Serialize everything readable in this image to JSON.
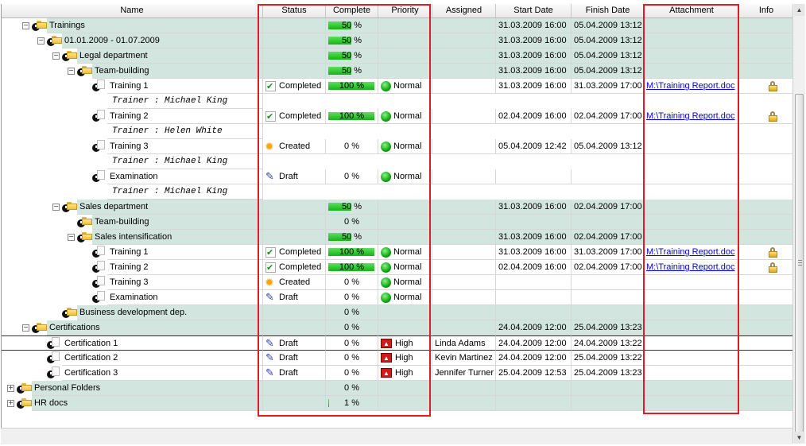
{
  "columns": {
    "name": "Name",
    "status": "Status",
    "complete": "Complete",
    "priority": "Priority",
    "assigned": "Assigned",
    "start_date": "Start Date",
    "finish_date": "Finish Date",
    "attachment": "Attachment",
    "info": "Info"
  },
  "rows": [
    {
      "name": "Trainings",
      "level": 1,
      "kind": "folder",
      "expander": "−",
      "complete_text": "50 %",
      "progress": 0.5,
      "start": "31.03.2009 16:00",
      "finish": "05.04.2009 13:12"
    },
    {
      "name": "01.01.2009 - 01.07.2009",
      "level": 2,
      "kind": "folder",
      "expander": "−",
      "complete_text": "50 %",
      "progress": 0.5,
      "start": "31.03.2009 16:00",
      "finish": "05.04.2009 13:12"
    },
    {
      "name": "Legal department",
      "level": 3,
      "kind": "folder",
      "expander": "−",
      "complete_text": "50 %",
      "progress": 0.5,
      "start": "31.03.2009 16:00",
      "finish": "05.04.2009 13:12"
    },
    {
      "name": "Team-building",
      "level": 4,
      "kind": "folder",
      "expander": "−",
      "complete_text": "50 %",
      "progress": 0.5,
      "start": "31.03.2009 16:00",
      "finish": "05.04.2009 13:12"
    },
    {
      "name": "Training 1",
      "level": 5,
      "kind": "task",
      "status": "Completed",
      "status_icon": "completed",
      "complete_text": "100 %",
      "progress": 1,
      "priority": "Normal",
      "priority_icon": "normal",
      "start": "31.03.2009 16:00",
      "finish": "31.03.2009 17:00",
      "attachment": "M:\\Training Report.doc",
      "info_icon": "lock-icon"
    },
    {
      "name": "Trainer : Michael King",
      "level": 5,
      "kind": "note"
    },
    {
      "name": "Training 2",
      "level": 5,
      "kind": "task",
      "status": "Completed",
      "status_icon": "completed",
      "complete_text": "100 %",
      "progress": 1,
      "priority": "Normal",
      "priority_icon": "normal",
      "start": "02.04.2009 16:00",
      "finish": "02.04.2009 17:00",
      "attachment": "M:\\Training Report.doc",
      "info_icon": "lock-icon"
    },
    {
      "name": "Trainer : Helen White",
      "level": 5,
      "kind": "note"
    },
    {
      "name": "Training 3",
      "level": 5,
      "kind": "task",
      "status": "Created",
      "status_icon": "created",
      "complete_text": "0 %",
      "progress": 0,
      "priority": "Normal",
      "priority_icon": "normal",
      "start": "05.04.2009 12:42",
      "finish": "05.04.2009 13:12"
    },
    {
      "name": "Trainer : Michael King",
      "level": 5,
      "kind": "note"
    },
    {
      "name": "Examination",
      "level": 5,
      "kind": "task",
      "status": "Draft",
      "status_icon": "draft",
      "complete_text": "0 %",
      "progress": 0,
      "priority": "Normal",
      "priority_icon": "normal"
    },
    {
      "name": "Trainer : Michael King",
      "level": 5,
      "kind": "note"
    },
    {
      "name": "Sales department",
      "level": 3,
      "kind": "folder",
      "expander": "−",
      "complete_text": "50 %",
      "progress": 0.5,
      "start": "31.03.2009 16:00",
      "finish": "02.04.2009 17:00"
    },
    {
      "name": "Team-building",
      "level": 4,
      "kind": "folder",
      "complete_text": "0 %",
      "progress": 0
    },
    {
      "name": "Sales intensification",
      "level": 4,
      "kind": "folder",
      "expander": "−",
      "complete_text": "50 %",
      "progress": 0.5,
      "start": "31.03.2009 16:00",
      "finish": "02.04.2009 17:00"
    },
    {
      "name": "Training 1",
      "level": 5,
      "kind": "task",
      "status": "Completed",
      "status_icon": "completed",
      "complete_text": "100 %",
      "progress": 1,
      "priority": "Normal",
      "priority_icon": "normal",
      "start": "31.03.2009 16:00",
      "finish": "31.03.2009 17:00",
      "attachment": "M:\\Training Report.doc",
      "info_icon": "lock-icon"
    },
    {
      "name": "Training 2",
      "level": 5,
      "kind": "task",
      "status": "Completed",
      "status_icon": "completed",
      "complete_text": "100 %",
      "progress": 1,
      "priority": "Normal",
      "priority_icon": "normal",
      "start": "02.04.2009 16:00",
      "finish": "02.04.2009 17:00",
      "attachment": "M:\\Training Report.doc",
      "info_icon": "lock-icon"
    },
    {
      "name": "Training 3",
      "level": 5,
      "kind": "task",
      "status": "Created",
      "status_icon": "created",
      "complete_text": "0 %",
      "progress": 0,
      "priority": "Normal",
      "priority_icon": "normal"
    },
    {
      "name": "Examination",
      "level": 5,
      "kind": "task",
      "status": "Draft",
      "status_icon": "draft",
      "complete_text": "0 %",
      "progress": 0,
      "priority": "Normal",
      "priority_icon": "normal"
    },
    {
      "name": "Business development dep.",
      "level": 3,
      "kind": "folder",
      "complete_text": "0 %",
      "progress": 0
    },
    {
      "name": "Certifications",
      "level": 1,
      "kind": "folder",
      "expander": "−",
      "complete_text": "0 %",
      "progress": 0,
      "start": "24.04.2009 12:00",
      "finish": "25.04.2009 13:23"
    },
    {
      "name": "Certification 1",
      "level": 2,
      "kind": "task",
      "status": "Draft",
      "status_icon": "draft",
      "complete_text": "0 %",
      "progress": 0,
      "priority": "High",
      "priority_icon": "high",
      "assigned": "Linda  Adams",
      "start": "24.04.2009 12:00",
      "finish": "24.04.2009 13:22",
      "selected": true
    },
    {
      "name": "Certification 2",
      "level": 2,
      "kind": "task",
      "status": "Draft",
      "status_icon": "draft",
      "complete_text": "0 %",
      "progress": 0,
      "priority": "High",
      "priority_icon": "high",
      "assigned": "Kevin Martinez",
      "start": "24.04.2009 12:00",
      "finish": "25.04.2009 13:22"
    },
    {
      "name": "Certification 3",
      "level": 2,
      "kind": "task",
      "status": "Draft",
      "status_icon": "draft",
      "complete_text": "0 %",
      "progress": 0,
      "priority": "High",
      "priority_icon": "high",
      "assigned": "Jennifer Turner",
      "start": "25.04.2009 12:53",
      "finish": "25.04.2009 13:23"
    },
    {
      "name": "Personal Folders",
      "level": 0,
      "kind": "folder",
      "expander": "+",
      "complete_text": "0 %",
      "progress": 0
    },
    {
      "name": "HR docs",
      "level": 0,
      "kind": "folder",
      "expander": "+",
      "complete_text": "1 %",
      "progress": 0.01
    }
  ],
  "colors": {
    "group_row": "#d3e5df",
    "progress": "#14b414",
    "highlight": "#e01b24",
    "link": "#0000ee"
  }
}
